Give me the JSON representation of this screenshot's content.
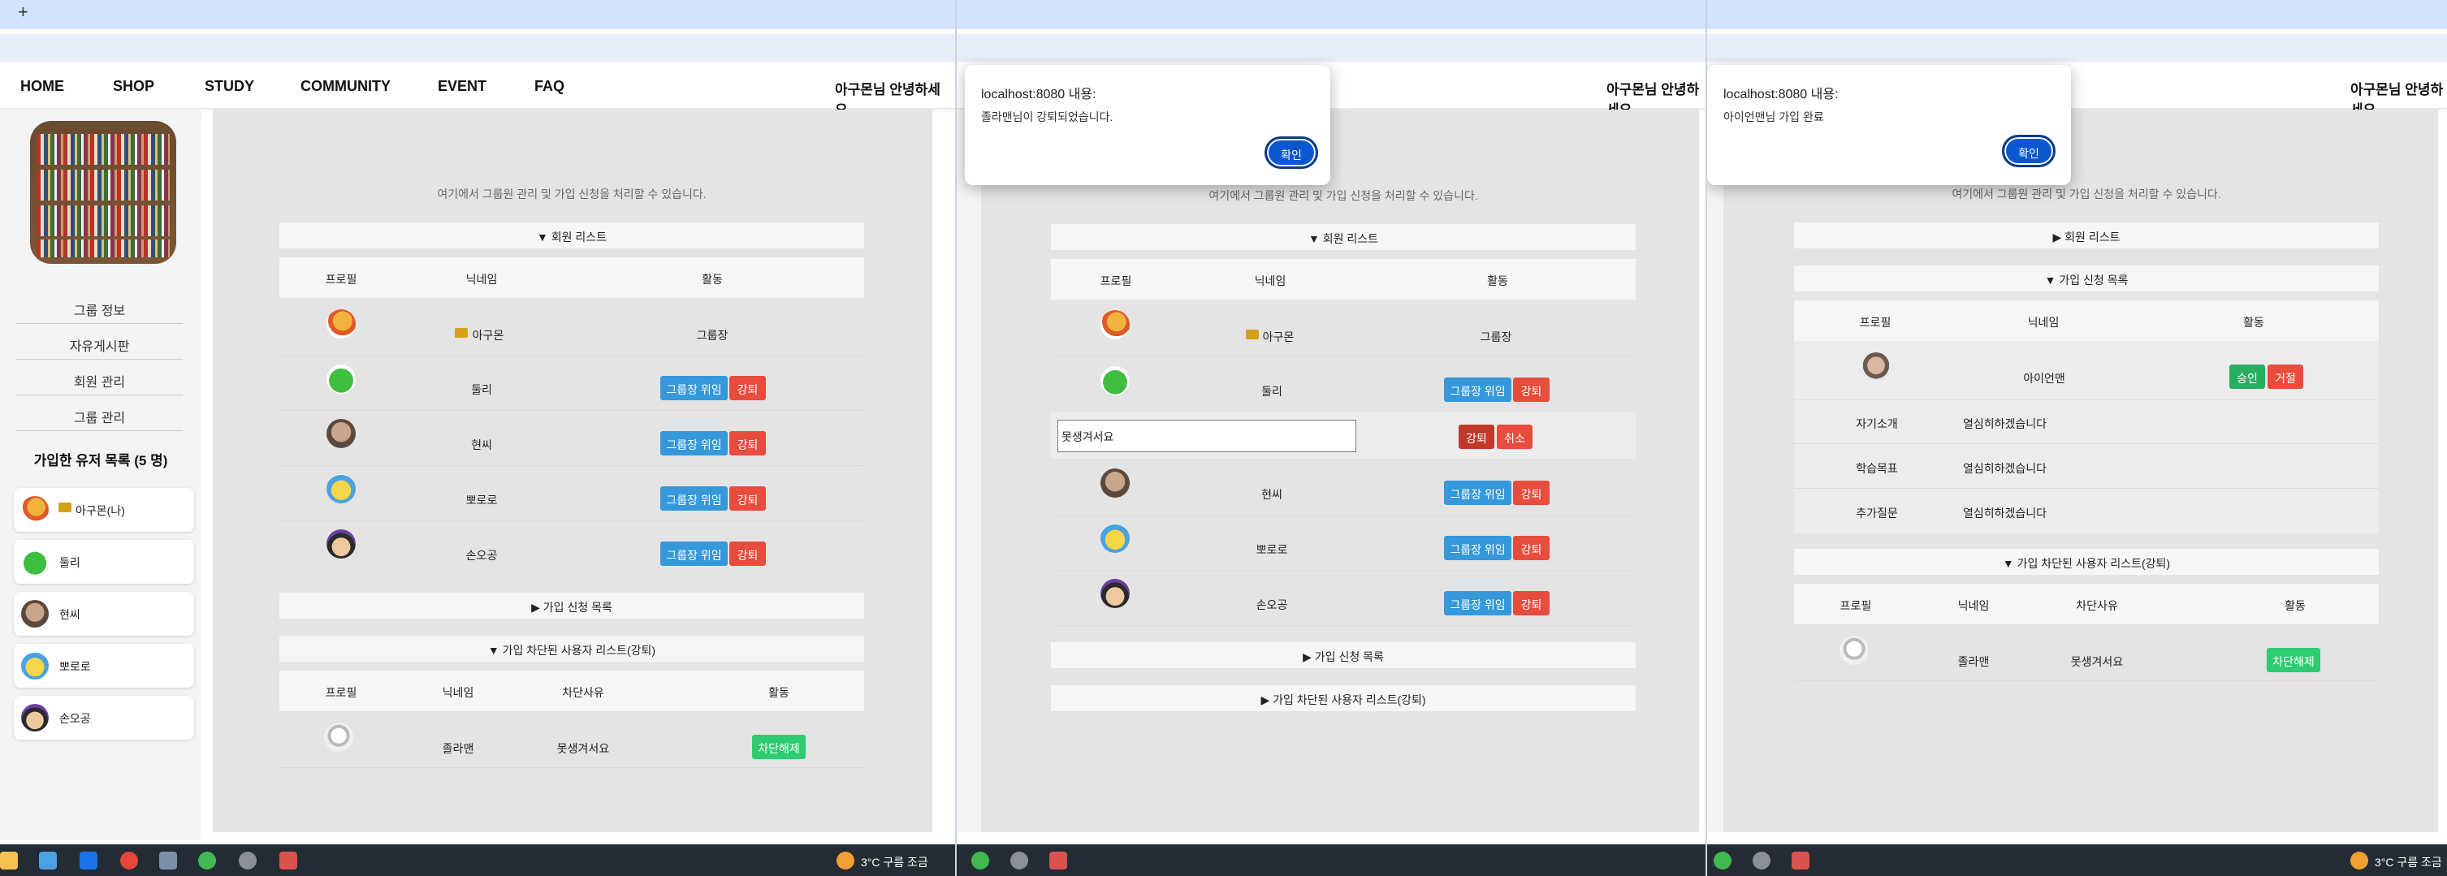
{
  "browser": {
    "newtab_symbol": "+"
  },
  "nav": {
    "items": [
      "HOME",
      "SHOP",
      "STUDY",
      "COMMUNITY",
      "EVENT",
      "FAQ"
    ],
    "greeting": "아구몬님 안녕하세요."
  },
  "sidebar": {
    "links": [
      "그룹 정보",
      "자유게시판",
      "회원 관리",
      "그룹 관리"
    ],
    "members_title": "가입한 유저 목록 (5 명)",
    "members": [
      "아구몬(나)",
      "둘리",
      "현씨",
      "뽀로로",
      "손오공"
    ]
  },
  "main": {
    "subtitle": "여기에서 그룹원 관리 및 가입 신청을 처리할 수 있습니다.",
    "member_list_open": "▼ 회원 리스트",
    "member_list_closed": "▶ 회원 리스트",
    "apply_list_closed": "▶ 가입 신청 목록",
    "apply_list_open": "▼ 가입 신청 목록",
    "banned_list_open": "▼ 가입 차단된 사용자 리스트(강퇴)",
    "banned_list_closed": "▶ 가입 차단된 사용자 리스트(강퇴)",
    "col_profile": "프로필",
    "col_nickname": "닉네임",
    "col_activity": "활동",
    "col_reason": "차단사유",
    "leader_role": "그룹장",
    "btn_delegate": "그룹장 위임",
    "btn_kick": "강퇴",
    "btn_cancel": "취소",
    "btn_unban": "차단해제",
    "btn_approve": "승인",
    "btn_reject": "거절",
    "members": [
      "아구몬",
      "둘리",
      "현씨",
      "뽀로로",
      "손오공"
    ],
    "banned": [
      {
        "nickname": "졸라맨",
        "reason": "못생겨서요"
      }
    ],
    "kick_reason_value": "못생겨서요",
    "applicant": {
      "nickname": "아이언맨",
      "fields": [
        {
          "label": "자기소개",
          "value": "열심히하겠습니다"
        },
        {
          "label": "학습목표",
          "value": "열심히하겠습니다"
        },
        {
          "label": "추가질문",
          "value": "열심히하겠습니다"
        }
      ]
    }
  },
  "dialogs": {
    "kick": {
      "title": "localhost:8080 내용:",
      "message": "졸라맨님이 강퇴되었습니다.",
      "ok": "확인"
    },
    "approve": {
      "title": "localhost:8080 내용:",
      "message": "아이언맨님 가입 완료",
      "ok": "확인"
    }
  },
  "taskbar": {
    "weather": "3°C  구름 조금"
  },
  "colors": {
    "blue": "#3498db",
    "red": "#e74c3c",
    "green": "#2ecc71",
    "dialog_button": "#0b57d0"
  }
}
